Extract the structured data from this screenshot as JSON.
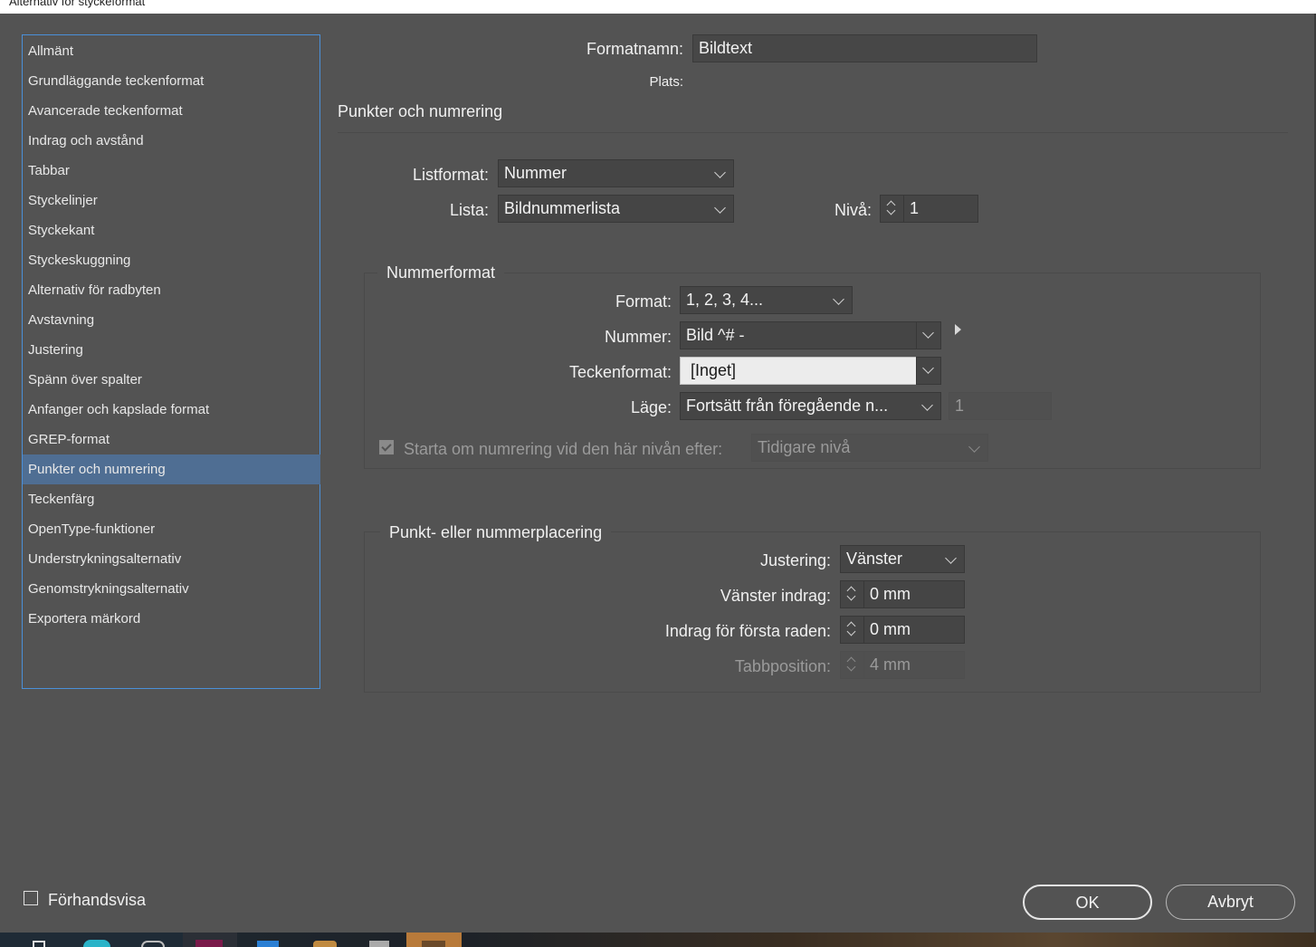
{
  "window": {
    "title": "Alternativ för styckeformat"
  },
  "sidebar": {
    "items": [
      {
        "label": "Allmänt"
      },
      {
        "label": "Grundläggande teckenformat"
      },
      {
        "label": "Avancerade teckenformat"
      },
      {
        "label": "Indrag och avstånd"
      },
      {
        "label": "Tabbar"
      },
      {
        "label": "Styckelinjer"
      },
      {
        "label": "Styckekant"
      },
      {
        "label": "Styckeskuggning"
      },
      {
        "label": "Alternativ för radbyten"
      },
      {
        "label": "Avstavning"
      },
      {
        "label": "Justering"
      },
      {
        "label": "Spänn över spalter"
      },
      {
        "label": "Anfanger och kapslade format"
      },
      {
        "label": "GREP-format"
      },
      {
        "label": "Punkter och numrering",
        "selected": true
      },
      {
        "label": "Teckenfärg"
      },
      {
        "label": "OpenType-funktioner"
      },
      {
        "label": "Understrykningsalternativ"
      },
      {
        "label": "Genomstrykningsalternativ"
      },
      {
        "label": "Exportera märkord"
      }
    ]
  },
  "header": {
    "style_name_label": "Formatnamn:",
    "style_name_value": "Bildtext",
    "location_label": "Plats:",
    "section_title": "Punkter och numrering"
  },
  "list": {
    "list_type_label": "Listformat:",
    "list_type_value": "Nummer",
    "list_label": "Lista:",
    "list_value": "Bildnummerlista",
    "level_label": "Nivå:",
    "level_value": "1"
  },
  "numbering_style": {
    "title": "Nummerformat",
    "format_label": "Format:",
    "format_value": "1, 2, 3, 4...",
    "number_label": "Nummer:",
    "number_value": "Bild ^# -",
    "char_style_label": "Teckenformat:",
    "char_style_value": "[Inget]",
    "mode_label": "Läge:",
    "mode_value": "Fortsätt från föregående n...",
    "mode_start_value": "1",
    "restart_checkbox_label": "Starta om numrering vid den här nivån efter:",
    "restart_checked": true,
    "restart_value": "Tidigare nivå"
  },
  "position": {
    "title": "Punkt- eller nummerplacering",
    "alignment_label": "Justering:",
    "alignment_value": "Vänster",
    "left_indent_label": "Vänster indrag:",
    "left_indent_value": "0 mm",
    "first_line_indent_label": "Indrag för första raden:",
    "first_line_indent_value": "0 mm",
    "tab_position_label": "Tabbposition:",
    "tab_position_value": "4 mm"
  },
  "footer": {
    "preview_label": "Förhandsvisa",
    "preview_checked": false,
    "ok_label": "OK",
    "cancel_label": "Avbryt"
  },
  "colors": {
    "background": "#535353",
    "selection": "#4f6e93",
    "focus_border": "#4a90d9"
  }
}
